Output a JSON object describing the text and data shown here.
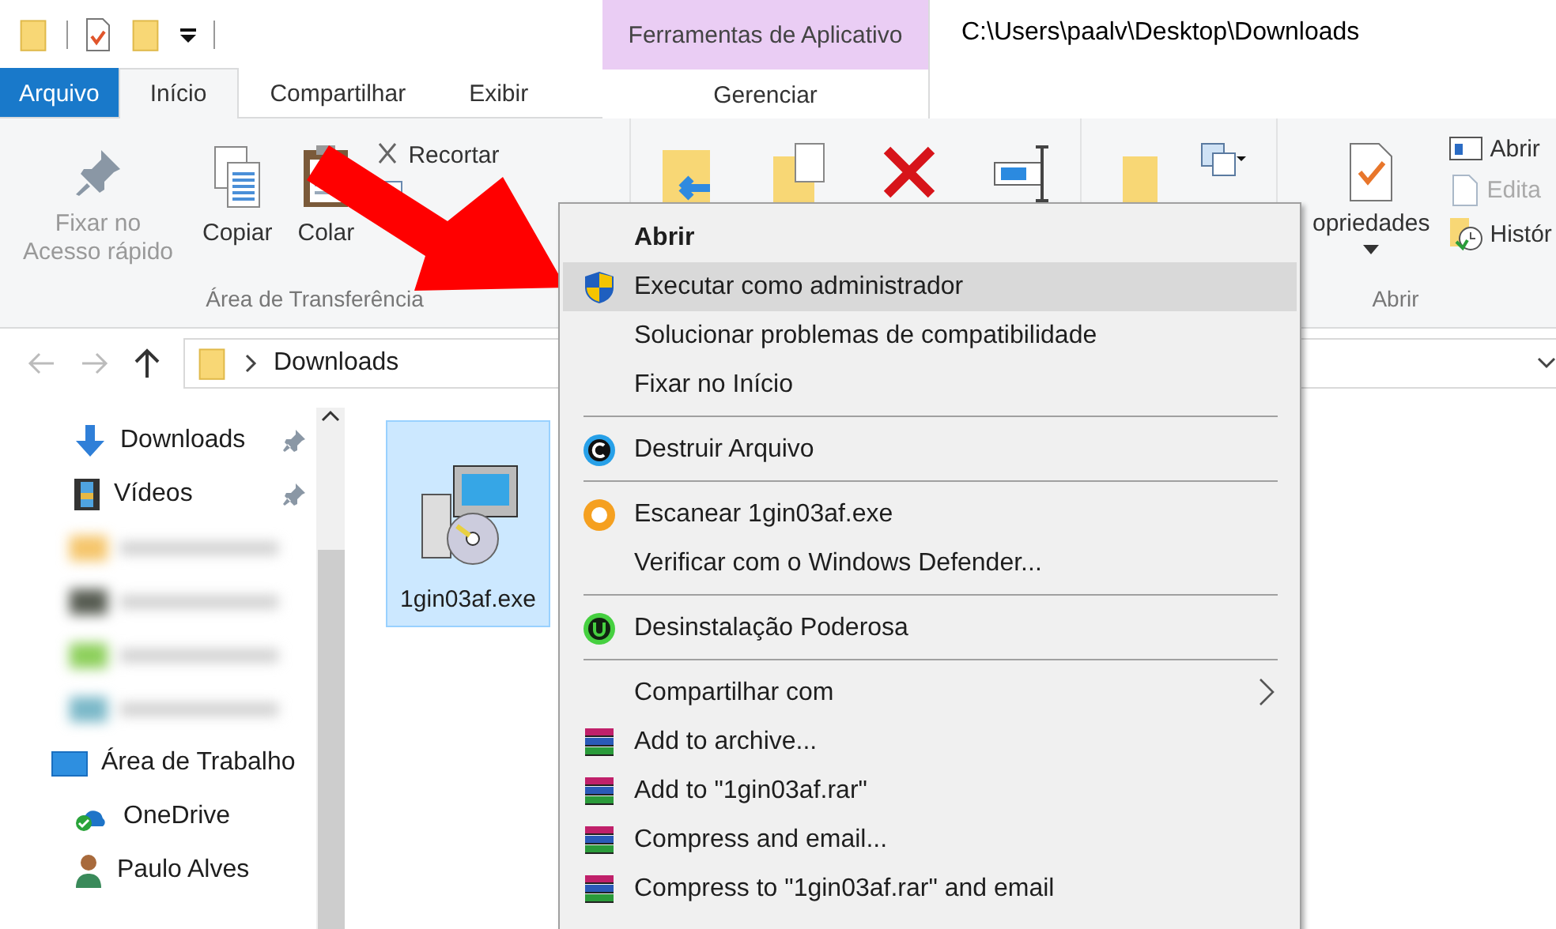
{
  "title": "C:\\Users\\paalv\\Desktop\\Downloads",
  "contextual_group": {
    "label": "Ferramentas de Aplicativo"
  },
  "tabs": [
    {
      "label": "Arquivo",
      "kind": "file",
      "selected": false
    },
    {
      "label": "Início",
      "kind": "tab",
      "selected": true
    },
    {
      "label": "Compartilhar",
      "kind": "tab",
      "selected": false
    },
    {
      "label": "Exibir",
      "kind": "tab",
      "selected": false
    },
    {
      "label": "Gerenciar",
      "kind": "contextual",
      "selected": false
    }
  ],
  "ribbon": {
    "clipboard": {
      "label": "Área de Transferência",
      "large": [
        {
          "label": "Fixar no Acesso rápido",
          "kind": "pin",
          "disabled": true
        },
        {
          "label": "Copiar",
          "kind": "copy",
          "disabled": false
        },
        {
          "label": "Colar",
          "kind": "paste",
          "disabled": false
        }
      ],
      "small": [
        {
          "label": "Recortar",
          "kind": "cut",
          "disabled": false
        }
      ]
    },
    "open": {
      "label": "Abrir",
      "large": [
        {
          "label": "opriedades",
          "kind": "properties",
          "disabled": false
        }
      ],
      "small": [
        {
          "label": "Abrir",
          "kind": "open",
          "disabled": false
        },
        {
          "label": "Edita",
          "kind": "edit",
          "disabled": true
        },
        {
          "label": "Histór",
          "kind": "history",
          "disabled": false
        }
      ]
    }
  },
  "address": {
    "segments": [
      "Downloads"
    ]
  },
  "sidebar": {
    "items": [
      {
        "label": "Downloads",
        "kind": "downloads",
        "pinned": true
      },
      {
        "label": "Vídeos",
        "kind": "videos",
        "pinned": true
      },
      {
        "kind": "blurred",
        "pinned": false
      },
      {
        "kind": "blurred",
        "pinned": false
      },
      {
        "kind": "blurred",
        "pinned": false
      },
      {
        "kind": "blurred",
        "pinned": false
      },
      {
        "label": "Área de Trabalho",
        "kind": "desktop",
        "pinned": false
      },
      {
        "label": "OneDrive",
        "kind": "onedrive",
        "pinned": false
      },
      {
        "label": "Paulo Alves",
        "kind": "user",
        "pinned": false
      }
    ]
  },
  "files": [
    {
      "name": "1gin03af.exe",
      "selected": true
    }
  ],
  "context_menu": {
    "items": [
      {
        "label": "Abrir",
        "kind": "plain",
        "bold": true,
        "selected": false
      },
      {
        "label": "Executar como administrador",
        "kind": "shield",
        "bold": false,
        "selected": true
      },
      {
        "label": "Solucionar problemas de compatibilidade",
        "kind": "plain",
        "bold": false,
        "selected": false
      },
      {
        "label": "Fixar no Início",
        "kind": "plain",
        "bold": false,
        "selected": false
      },
      {
        "kind": "separator"
      },
      {
        "label": "Destruir Arquivo",
        "kind": "shred",
        "bold": false,
        "selected": false
      },
      {
        "kind": "separator"
      },
      {
        "label": "Escanear 1gin03af.exe",
        "kind": "scan",
        "bold": false,
        "selected": false
      },
      {
        "label": "Verificar com o Windows Defender...",
        "kind": "plain",
        "bold": false,
        "selected": false
      },
      {
        "kind": "separator"
      },
      {
        "label": "Desinstalação Poderosa",
        "kind": "uninstall",
        "bold": false,
        "selected": false
      },
      {
        "kind": "separator"
      },
      {
        "label": "Compartilhar com",
        "kind": "submenu",
        "bold": false,
        "selected": false
      },
      {
        "label": "Add to archive...",
        "kind": "archive",
        "bold": false,
        "selected": false
      },
      {
        "label": "Add to \"1gin03af.rar\"",
        "kind": "archive",
        "bold": false,
        "selected": false
      },
      {
        "label": "Compress and email...",
        "kind": "archive",
        "bold": false,
        "selected": false
      },
      {
        "label": "Compress to \"1gin03af.rar\" and email",
        "kind": "archive",
        "bold": false,
        "selected": false
      }
    ]
  }
}
